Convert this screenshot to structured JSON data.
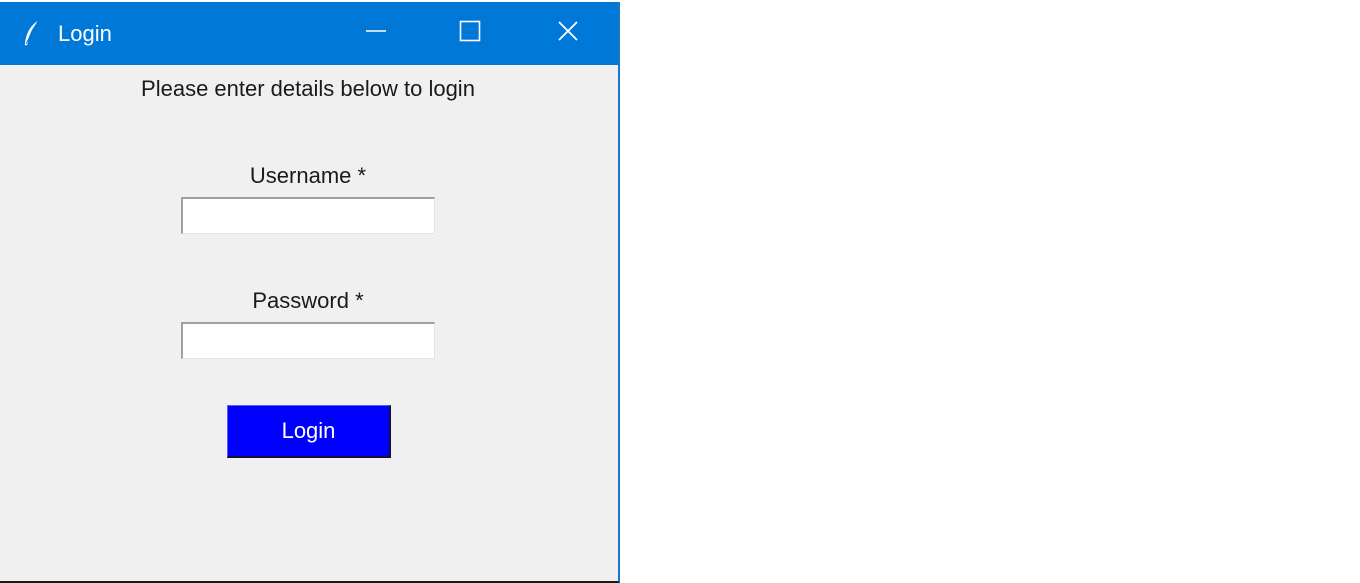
{
  "window": {
    "title": "Login",
    "controls": {
      "minimize_icon": "minimize-icon",
      "maximize_icon": "maximize-icon",
      "close_icon": "close-icon"
    }
  },
  "form": {
    "instructions": "Please enter details below to login",
    "username": {
      "label": "Username *",
      "value": "",
      "placeholder": ""
    },
    "password": {
      "label": "Password *",
      "value": "",
      "placeholder": ""
    },
    "submit_label": "Login"
  },
  "colors": {
    "titlebar": "#0078d7",
    "window_background": "#f0f0f0",
    "login_button": "#0000ff",
    "login_button_text": "#ffffff"
  }
}
